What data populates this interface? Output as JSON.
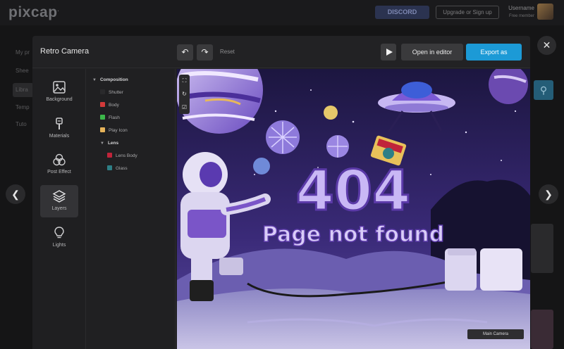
{
  "app": {
    "logo": "pixcap",
    "discord_label": "DISCORD",
    "upgrade_label": "Upgrade or Sign up",
    "username": "Username",
    "user_sub": "Free member"
  },
  "background_sidebar": [
    "My pr",
    "Shee",
    "Libra",
    "Temp",
    "Tuto"
  ],
  "modal": {
    "title": "Retro Camera",
    "reset_label": "Reset",
    "open_label": "Open in editor",
    "export_label": "Export as"
  },
  "tools": [
    {
      "label": "Background",
      "icon": "image-icon"
    },
    {
      "label": "Materials",
      "icon": "brush-icon"
    },
    {
      "label": "Post Effect",
      "icon": "circles-icon"
    },
    {
      "label": "Layers",
      "icon": "layers-icon"
    },
    {
      "label": "Lights",
      "icon": "lightbulb-icon"
    }
  ],
  "layers": {
    "group": "Composition",
    "items": [
      {
        "label": "Shutter",
        "color": "#2a2a2c"
      },
      {
        "label": "Body",
        "color": "#d23a3a"
      },
      {
        "label": "Flash",
        "color": "#3cb84a"
      },
      {
        "label": "Play Icon",
        "color": "#e6b35a"
      }
    ],
    "subgroup": "Lens",
    "subitems": [
      {
        "label": "Lens Body",
        "color": "#c0243a"
      },
      {
        "label": "Glass",
        "color": "#2e7f86"
      }
    ]
  },
  "viewport": {
    "headline": "404",
    "subline": "Page not found",
    "camera_label": "Main Camera"
  },
  "colors": {
    "accent": "#1c9ad6",
    "modal_bg": "#202022"
  }
}
